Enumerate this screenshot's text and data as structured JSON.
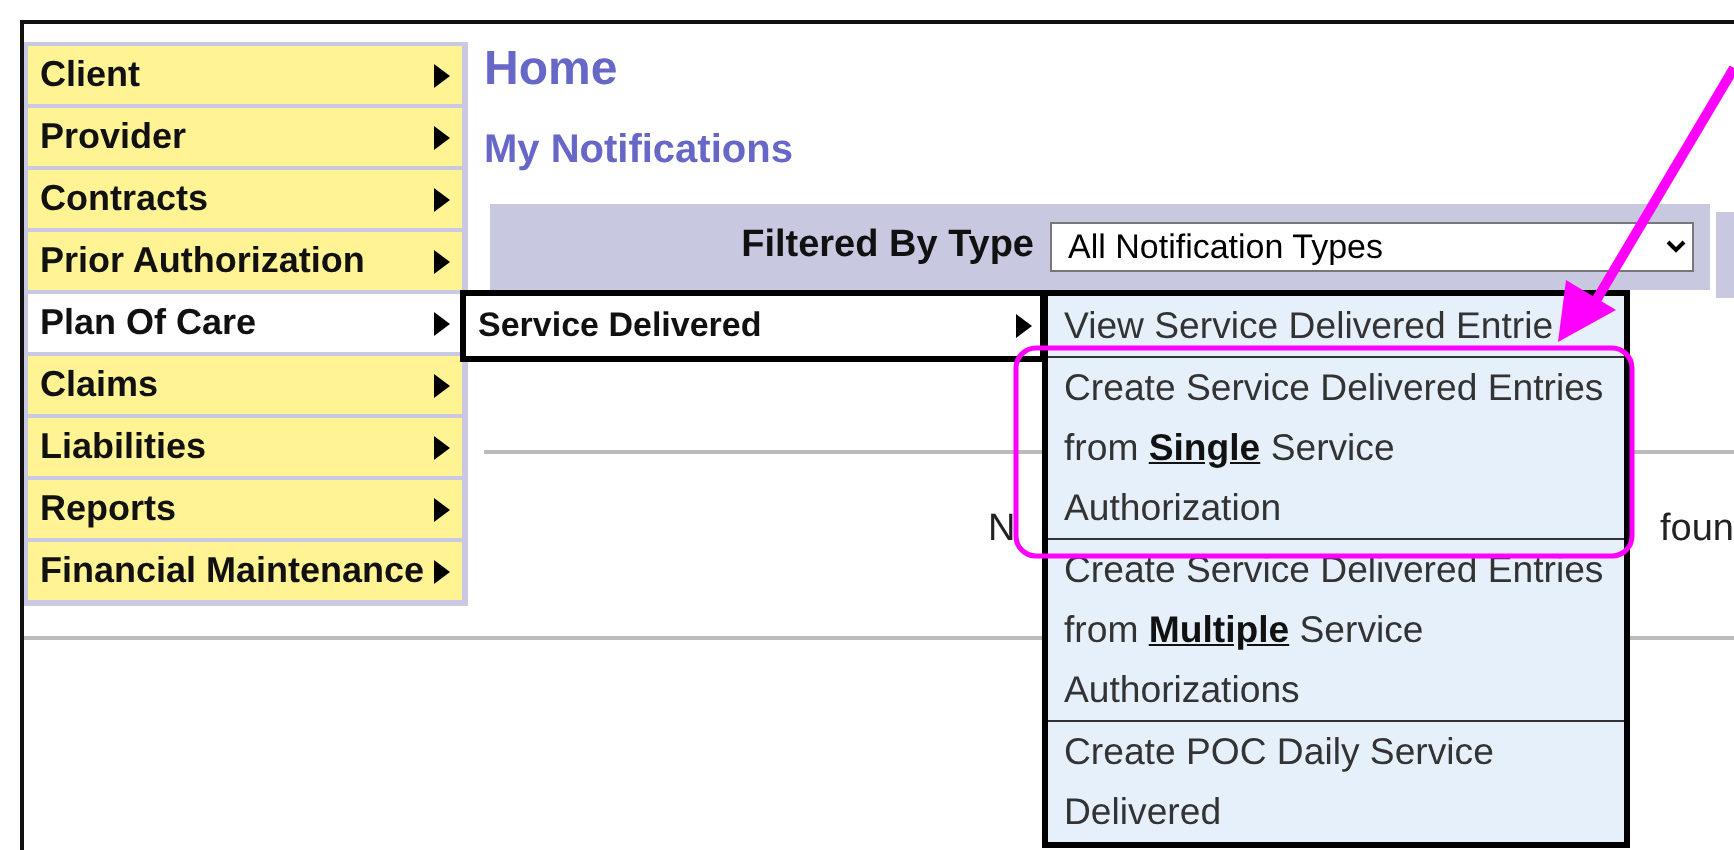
{
  "menu": {
    "items": [
      {
        "label": "Client",
        "selected": false
      },
      {
        "label": "Provider",
        "selected": false
      },
      {
        "label": "Contracts",
        "selected": false
      },
      {
        "label": "Prior Authorization",
        "selected": false
      },
      {
        "label": "Plan Of Care",
        "selected": true
      },
      {
        "label": "Claims",
        "selected": false
      },
      {
        "label": "Liabilities",
        "selected": false
      },
      {
        "label": "Reports",
        "selected": false
      },
      {
        "label": "Financial Maintenance",
        "selected": false
      }
    ]
  },
  "submenu": {
    "items": [
      {
        "label": "Service Delivered"
      }
    ]
  },
  "flyout": {
    "items": [
      {
        "label": "View Service Delivered Entrie"
      },
      {
        "label": "Create Service Delivered Entries from **Single** Service Authorization"
      },
      {
        "label": "Create Service Delivered Entries from **Multiple** Service Authorizations"
      },
      {
        "label": "Create POC Daily Service Delivered"
      }
    ]
  },
  "page": {
    "title": "Home",
    "subtitle": "My Notifications",
    "filter": {
      "label": "Filtered By Type",
      "value": "All Notification Types"
    },
    "notice": [
      "N",
      "foun"
    ]
  },
  "annotations": {
    "arrow": true,
    "highlight_box": true
  }
}
